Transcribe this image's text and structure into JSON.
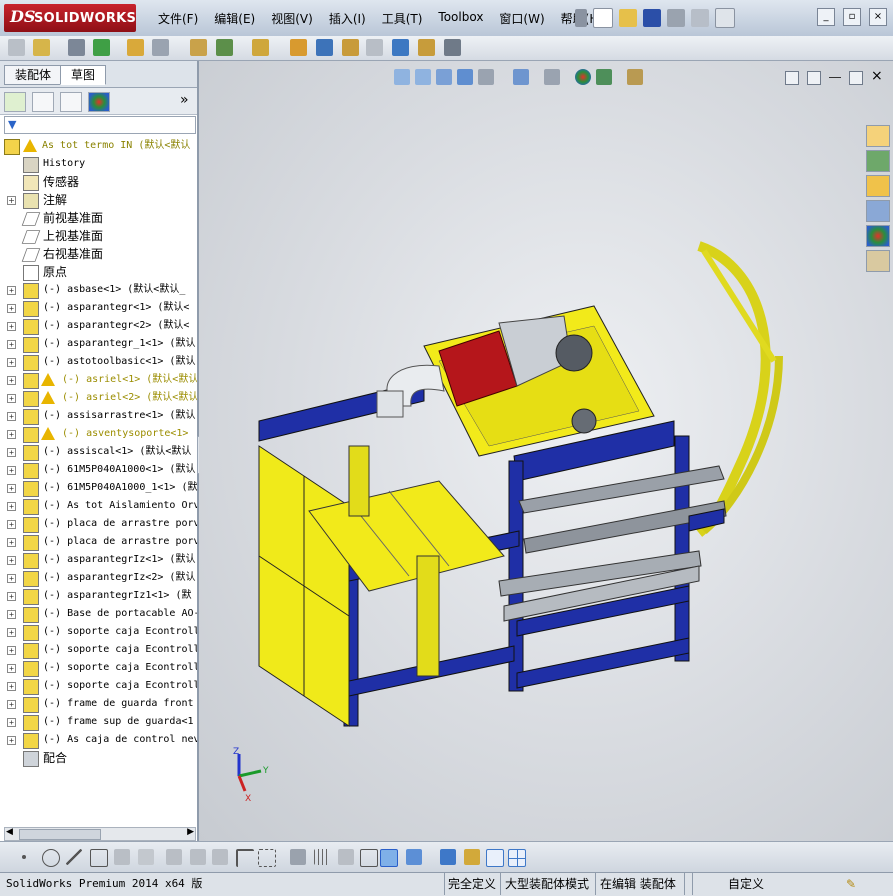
{
  "app": {
    "logo_ds": "DS",
    "logo_name": "SOLIDWORKS"
  },
  "menu": [
    "文件(F)",
    "编辑(E)",
    "视图(V)",
    "插入(I)",
    "工具(T)",
    "Toolbox",
    "窗口(W)",
    "帮助(H)"
  ],
  "panel": {
    "tabs": [
      "装配体",
      "草图"
    ],
    "collapse_label": "»"
  },
  "tree": {
    "root": "As tot termo IN  (默认<默认",
    "items": [
      {
        "label": "History",
        "cn": false,
        "icon": "history-icon",
        "exp": false
      },
      {
        "label": "传感器",
        "cn": true,
        "icon": "sensor-icon",
        "exp": false
      },
      {
        "label": "注解",
        "cn": true,
        "icon": "annotation-icon",
        "exp": true
      },
      {
        "label": "前视基准面",
        "cn": true,
        "icon": "plane-icon",
        "exp": false
      },
      {
        "label": "上视基准面",
        "cn": true,
        "icon": "plane-icon",
        "exp": false
      },
      {
        "label": "右视基准面",
        "cn": true,
        "icon": "plane-icon",
        "exp": false
      },
      {
        "label": "原点",
        "cn": true,
        "icon": "origin-icon",
        "exp": false
      },
      {
        "label": "(-) asbase<1> (默认<默认_",
        "cn": false,
        "icon": "part-icon",
        "exp": true
      },
      {
        "label": "(-) asparantegr<1> (默认<",
        "cn": false,
        "icon": "part-icon",
        "exp": true
      },
      {
        "label": "(-) asparantegr<2> (默认<",
        "cn": false,
        "icon": "part-icon",
        "exp": true
      },
      {
        "label": "(-) asparantegr_1<1> (默认",
        "cn": false,
        "icon": "part-icon",
        "exp": true
      },
      {
        "label": "(-) astotoolbasic<1> (默认",
        "cn": false,
        "icon": "part-icon",
        "exp": true
      },
      {
        "label": "(-) asriel<1> (默认<默认",
        "cn": false,
        "icon": "part-icon",
        "exp": true,
        "warn": true
      },
      {
        "label": "(-) asriel<2> (默认<默认",
        "cn": false,
        "icon": "part-icon",
        "exp": true,
        "warn": true
      },
      {
        "label": "(-) assisarrastre<1> (默认",
        "cn": false,
        "icon": "part-icon",
        "exp": true
      },
      {
        "label": "(-) asventysoporte<1>",
        "cn": false,
        "icon": "part-icon",
        "exp": true,
        "warn": true
      },
      {
        "label": "(-) assiscal<1> (默认<默认",
        "cn": false,
        "icon": "part-icon",
        "exp": true
      },
      {
        "label": "(-) 61M5P040A1000<1> (默认",
        "cn": false,
        "icon": "part-icon",
        "exp": true
      },
      {
        "label": "(-) 61M5P040A1000_1<1> (默",
        "cn": false,
        "icon": "part-icon",
        "exp": true
      },
      {
        "label": "(-) As tot Aislamiento Orv",
        "cn": false,
        "icon": "part-icon",
        "exp": true
      },
      {
        "label": "(-) placa de arrastre porv",
        "cn": false,
        "icon": "part-icon",
        "exp": true
      },
      {
        "label": "(-) placa de arrastre porv",
        "cn": false,
        "icon": "part-icon",
        "exp": true
      },
      {
        "label": "(-) asparantegrIz<1> (默认",
        "cn": false,
        "icon": "part-icon",
        "exp": true
      },
      {
        "label": "(-) asparantegrIz<2> (默认",
        "cn": false,
        "icon": "part-icon",
        "exp": true
      },
      {
        "label": "(-) asparantegrIz1<1> (默",
        "cn": false,
        "icon": "part-icon",
        "exp": true
      },
      {
        "label": "(-) Base de portacable AO-",
        "cn": false,
        "icon": "part-icon",
        "exp": true
      },
      {
        "label": "(-) soporte caja Econtroll",
        "cn": false,
        "icon": "part-icon",
        "exp": true
      },
      {
        "label": "(-) soporte caja Econtroll",
        "cn": false,
        "icon": "part-icon",
        "exp": true
      },
      {
        "label": "(-) soporte caja Econtroll",
        "cn": false,
        "icon": "part-icon",
        "exp": true
      },
      {
        "label": "(-) soporte caja Econtroll",
        "cn": false,
        "icon": "part-icon",
        "exp": true
      },
      {
        "label": "(-) frame de guarda front",
        "cn": false,
        "icon": "part-icon",
        "exp": true
      },
      {
        "label": "(-) frame sup de guarda<1",
        "cn": false,
        "icon": "part-icon",
        "exp": true
      },
      {
        "label": "(-) As caja de control nev",
        "cn": false,
        "icon": "part-icon",
        "exp": true
      },
      {
        "label": "配合",
        "cn": true,
        "icon": "mates-icon",
        "exp": false
      }
    ]
  },
  "triad": {
    "z": "Z",
    "y": "Y",
    "x": "X"
  },
  "status": {
    "version": "SolidWorks Premium 2014 x64 版",
    "definition": "完全定义",
    "mode": "大型装配体模式",
    "editing": "在编辑 装配体",
    "units": "自定义"
  },
  "colors": {
    "frame_blue": "#1f2fa6",
    "panel_yellow": "#f0ea1a",
    "fan_red": "#b5161b",
    "warning_yellow": "#e8b500"
  }
}
